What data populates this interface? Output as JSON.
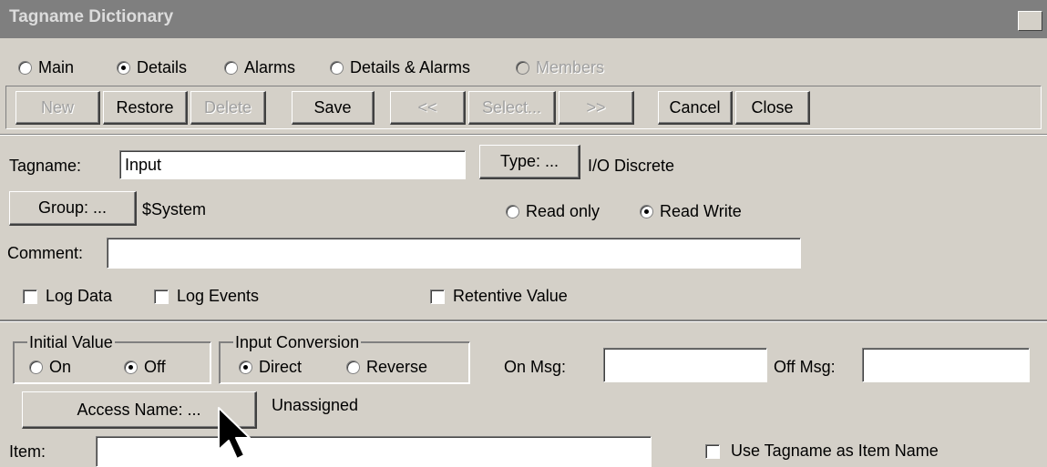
{
  "window": {
    "title": "Tagname Dictionary",
    "close_glyph": "✕"
  },
  "view_options": [
    {
      "label": "Main",
      "selected": false,
      "enabled": true
    },
    {
      "label": "Details",
      "selected": true,
      "enabled": true
    },
    {
      "label": "Alarms",
      "selected": false,
      "enabled": true
    },
    {
      "label": "Details & Alarms",
      "selected": false,
      "enabled": true
    },
    {
      "label": "Members",
      "selected": false,
      "enabled": false
    }
  ],
  "toolbar": {
    "new": "New",
    "restore": "Restore",
    "delete": "Delete",
    "save": "Save",
    "prev": "<<",
    "select": "Select...",
    "next": ">>",
    "cancel": "Cancel",
    "close": "Close"
  },
  "details": {
    "tagname_label": "Tagname:",
    "tagname_value": "Input",
    "type_button": "Type: ...",
    "type_value": "I/O Discrete",
    "group_button": "Group: ...",
    "group_value": "$System",
    "read_only": "Read only",
    "read_write": "Read Write",
    "access_selected": "Read Write",
    "comment_label": "Comment:",
    "comment_value": "",
    "log_data": "Log Data",
    "log_events": "Log Events",
    "retentive_value": "Retentive Value"
  },
  "io": {
    "initial_value_legend": "Initial Value",
    "on": "On",
    "off": "Off",
    "initial_selected": "Off",
    "input_conversion_legend": "Input Conversion",
    "direct": "Direct",
    "reverse": "Reverse",
    "conversion_selected": "Direct",
    "on_msg_label": "On Msg:",
    "on_msg_value": "",
    "off_msg_label": "Off Msg:",
    "off_msg_value": "",
    "access_name_button": "Access Name: ...",
    "access_name_value": "Unassigned",
    "item_label": "Item:",
    "item_value": "",
    "use_tagname": "Use Tagname as Item Name"
  },
  "icons": {
    "cursor": "mouse-pointer-icon"
  }
}
